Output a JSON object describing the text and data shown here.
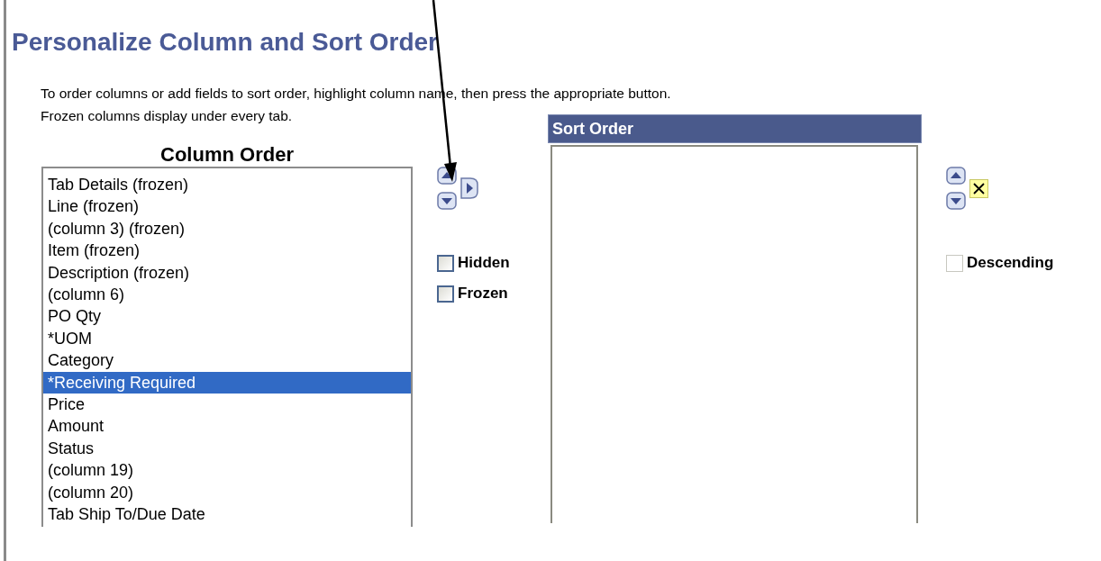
{
  "title": "Personalize Column and Sort Order",
  "instructions": [
    "To order columns or add fields to sort order, highlight column name, then press the appropriate button.",
    "Frozen columns display under every tab."
  ],
  "column_order": {
    "heading": "Column Order",
    "items": [
      {
        "label": "Tab Details (frozen)",
        "selected": false
      },
      {
        "label": "Line (frozen)",
        "selected": false
      },
      {
        "label": "(column 3) (frozen)",
        "selected": false
      },
      {
        "label": "Item (frozen)",
        "selected": false
      },
      {
        "label": "Description (frozen)",
        "selected": false
      },
      {
        "label": "(column 6)",
        "selected": false
      },
      {
        "label": "PO Qty",
        "selected": false
      },
      {
        "label": "*UOM",
        "selected": false
      },
      {
        "label": "Category",
        "selected": false
      },
      {
        "label": "*Receiving Required",
        "selected": true
      },
      {
        "label": "Price",
        "selected": false
      },
      {
        "label": "Amount",
        "selected": false
      },
      {
        "label": "Status",
        "selected": false
      },
      {
        "label": "(column 19)",
        "selected": false
      },
      {
        "label": "(column 20)",
        "selected": false
      },
      {
        "label": "Tab Ship To/Due Date",
        "selected": false
      }
    ]
  },
  "column_options": [
    {
      "label": "Hidden",
      "checked": false,
      "disabled": false
    },
    {
      "label": "Frozen",
      "checked": false,
      "disabled": false
    }
  ],
  "sort_order": {
    "heading": "Sort Order"
  },
  "sort_options": [
    {
      "label": "Descending",
      "checked": false,
      "disabled": true
    }
  ]
}
